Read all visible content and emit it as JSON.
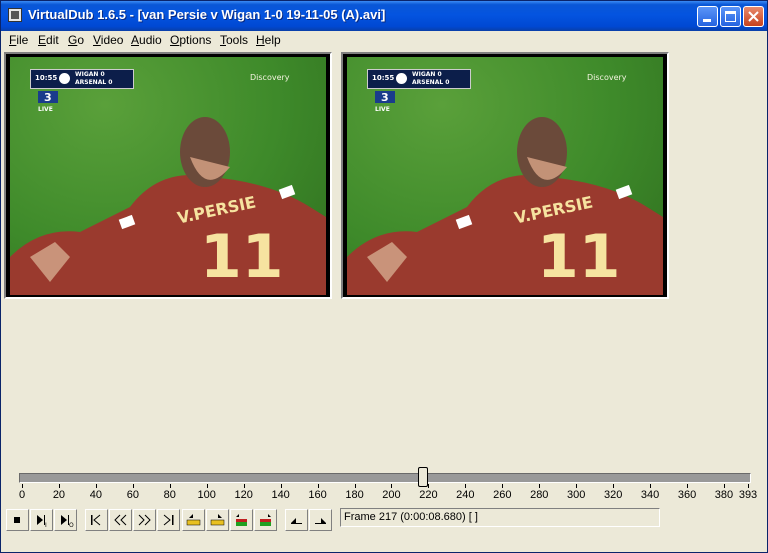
{
  "window": {
    "title": "VirtualDub 1.6.5 - [van Persie v Wigan 1-0 19-11-05 (A).avi]"
  },
  "menubar": {
    "items": [
      "File",
      "Edit",
      "Go",
      "Video",
      "Audio",
      "Options",
      "Tools",
      "Help"
    ]
  },
  "video": {
    "clock": "10:55",
    "team1": "WIGAN",
    "score1": "0",
    "team2": "ARSENAL",
    "score2": "0",
    "channel": "3",
    "channel_sub": "LIVE",
    "watermark": "Discovery",
    "shirt_name": "V.PERSIE",
    "shirt_number": "11"
  },
  "timeline": {
    "tick_labels": [
      "0",
      "20",
      "40",
      "60",
      "80",
      "100",
      "120",
      "140",
      "160",
      "180",
      "200",
      "220",
      "240",
      "260",
      "280",
      "300",
      "320",
      "340",
      "360",
      "380",
      "393"
    ],
    "max_frame": 393,
    "current_frame": 217
  },
  "toolbar": {
    "buttons": [
      "stop-icon",
      "play-input-icon",
      "play-output-icon",
      "start-icon",
      "prev-frame-icon",
      "next-frame-icon",
      "end-icon",
      "prev-keyframe-icon",
      "next-keyframe-icon",
      "scene-back-icon",
      "scene-forward-icon",
      "mark-in-icon",
      "mark-out-icon"
    ]
  },
  "status": {
    "text": "Frame 217 (0:00:08.680) [ ]"
  },
  "colors": {
    "titlebar": "#0454e0",
    "shirt": "#9a3a2e",
    "pitch": "#3e8a2a"
  }
}
